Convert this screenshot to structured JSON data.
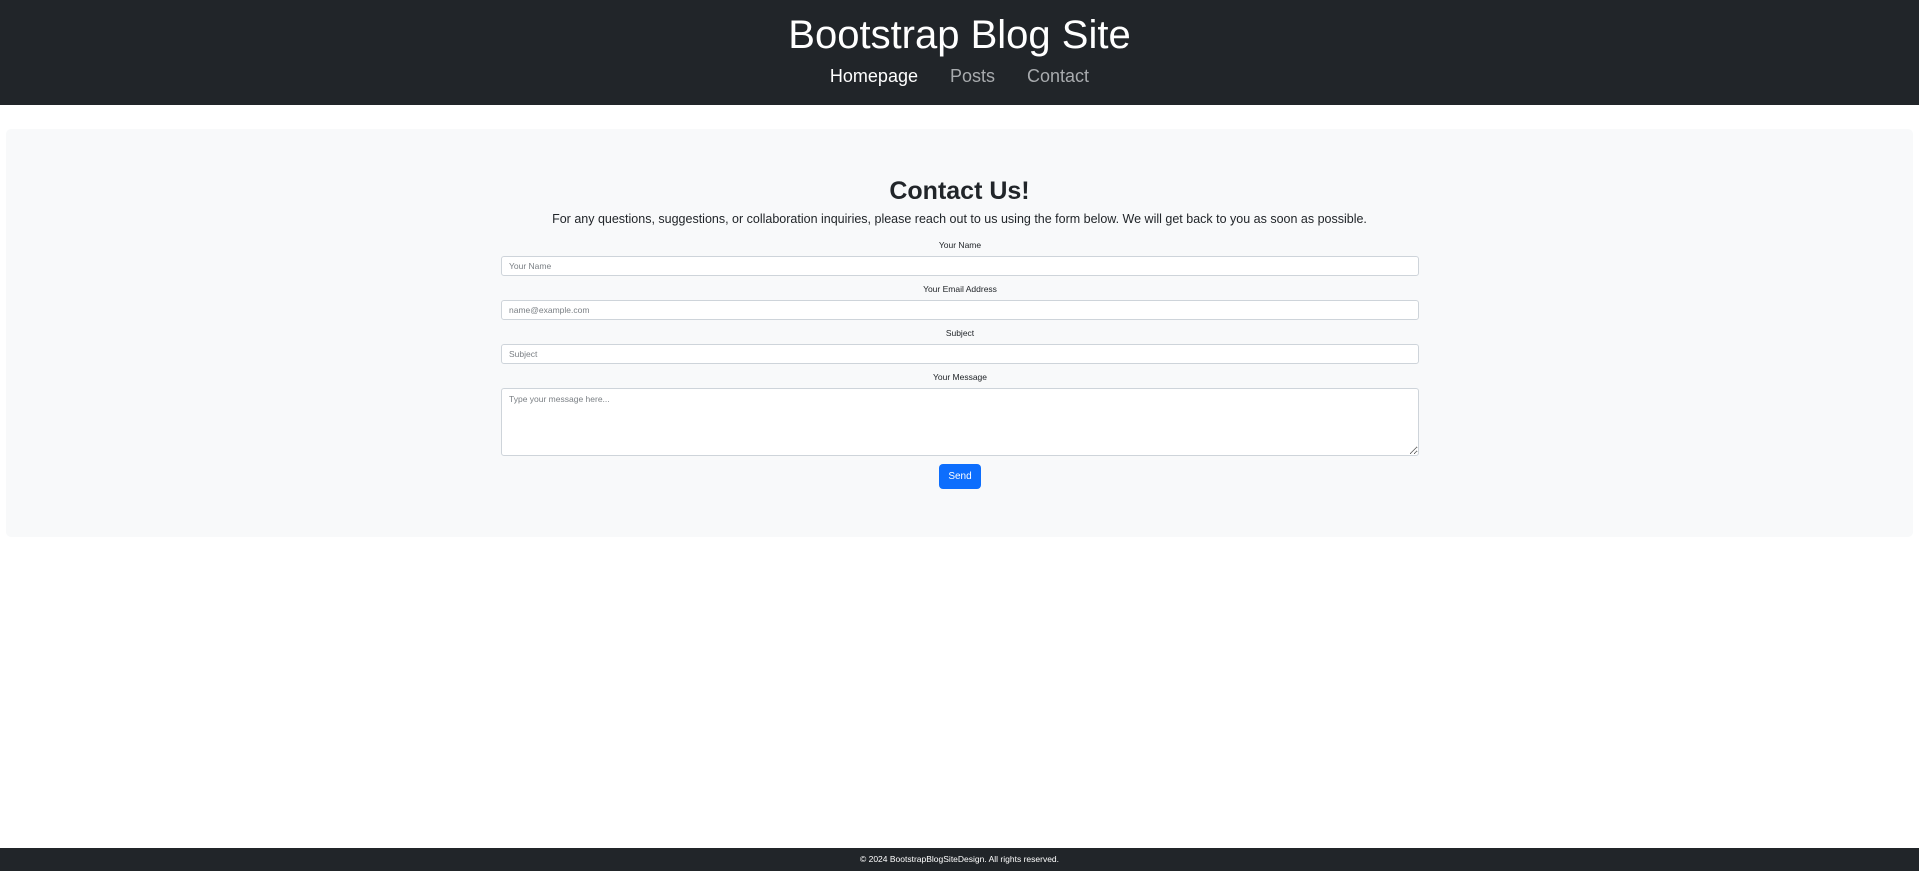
{
  "header": {
    "title": "Bootstrap Blog Site",
    "nav": [
      {
        "label": "Homepage",
        "active": true
      },
      {
        "label": "Posts",
        "active": false
      },
      {
        "label": "Contact",
        "active": false
      }
    ]
  },
  "contact": {
    "title": "Contact Us!",
    "intro": "For any questions, suggestions, or collaboration inquiries, please reach out to us using the form below. We will get back to you as soon as possible.",
    "fields": {
      "name": {
        "label": "Your Name",
        "placeholder": "Your Name",
        "value": ""
      },
      "email": {
        "label": "Your Email Address",
        "placeholder": "name@example.com",
        "value": ""
      },
      "subject": {
        "label": "Subject",
        "placeholder": "Subject",
        "value": ""
      },
      "message": {
        "label": "Your Message",
        "placeholder": "Type your message here...",
        "value": ""
      }
    },
    "send_label": "Send"
  },
  "footer": {
    "text": "© 2024 BootstrapBlogSiteDesign. All rights reserved."
  },
  "colors": {
    "header_bg": "#212529",
    "panel_bg": "#f8f9fa",
    "accent": "#0d6efd",
    "nav_active": "#ffffff",
    "nav_inactive": "#a8abae"
  }
}
